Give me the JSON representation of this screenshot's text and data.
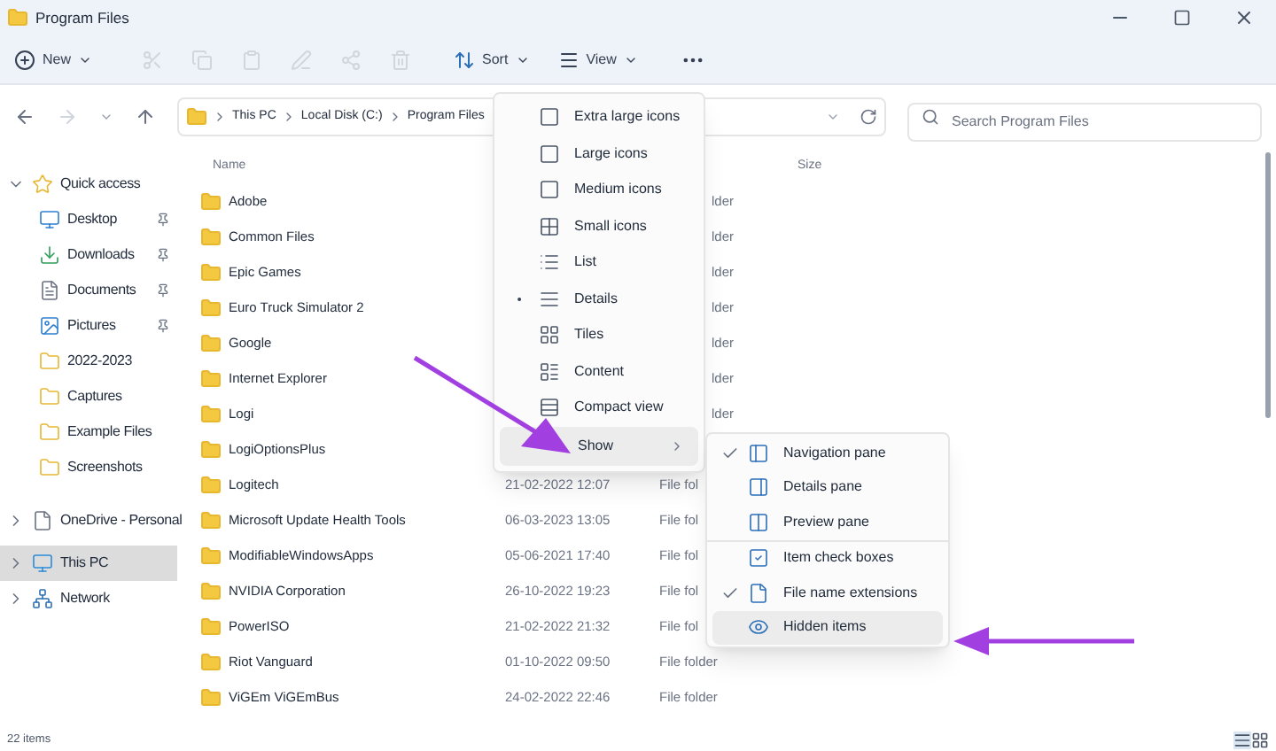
{
  "window": {
    "title": "Program Files"
  },
  "toolbar": {
    "new": "New",
    "sort": "Sort",
    "view": "View"
  },
  "address": {
    "crumbs": [
      "This PC",
      "Local Disk (C:)",
      "Program Files"
    ],
    "search_placeholder": "Search Program Files"
  },
  "sidebar": {
    "items": [
      {
        "label": "Quick access",
        "expanded": true,
        "selected": false,
        "children": [
          {
            "label": "Desktop",
            "pinned": true,
            "selected": false
          },
          {
            "label": "Downloads",
            "pinned": true,
            "selected": false
          },
          {
            "label": "Documents",
            "pinned": true,
            "selected": false
          },
          {
            "label": "Pictures",
            "pinned": true,
            "selected": false
          },
          {
            "label": "2022-2023",
            "pinned": false,
            "selected": false
          },
          {
            "label": "Captures",
            "pinned": false,
            "selected": false
          },
          {
            "label": "Example Files",
            "pinned": false,
            "selected": false
          },
          {
            "label": "Screenshots",
            "pinned": false,
            "selected": false
          }
        ]
      },
      {
        "label": "OneDrive - Personal",
        "expanded": false,
        "selected": false
      },
      {
        "label": "This PC",
        "expanded": false,
        "selected": true
      },
      {
        "label": "Network",
        "expanded": false,
        "selected": false
      }
    ]
  },
  "table": {
    "columns": [
      "Name",
      "Size"
    ],
    "rows": [
      {
        "name": "Adobe",
        "type": "lder"
      },
      {
        "name": "Common Files",
        "type": "lder"
      },
      {
        "name": "Epic Games",
        "type": "lder"
      },
      {
        "name": "Euro Truck Simulator 2",
        "type": "lder"
      },
      {
        "name": "Google",
        "type": "lder"
      },
      {
        "name": "Internet Explorer",
        "type": "lder"
      },
      {
        "name": "Logi",
        "type": "lder"
      },
      {
        "name": "LogiOptionsPlus"
      },
      {
        "name": "Logitech",
        "date": "21-02-2022 12:07",
        "type": "File fol"
      },
      {
        "name": "Microsoft Update Health Tools",
        "date": "06-03-2023 13:05",
        "type": "File fol"
      },
      {
        "name": "ModifiableWindowsApps",
        "date": "05-06-2021 17:40",
        "type": "File fol"
      },
      {
        "name": "NVIDIA Corporation",
        "date": "26-10-2022 19:23",
        "type": "File fol"
      },
      {
        "name": "PowerISO",
        "date": "21-02-2022 21:32",
        "type": "File fol"
      },
      {
        "name": "Riot Vanguard",
        "date": "01-10-2022 09:50",
        "type": "File folder"
      },
      {
        "name": "ViGEm ViGEmBus",
        "date": "24-02-2022 22:46",
        "type": "File folder"
      }
    ]
  },
  "status_bar": {
    "count": "22 items"
  },
  "view_menu": {
    "items": [
      {
        "label": "Extra large icons",
        "selected": false,
        "kind": "option"
      },
      {
        "label": "Large icons",
        "selected": false,
        "kind": "option"
      },
      {
        "label": "Medium icons",
        "selected": false,
        "kind": "option"
      },
      {
        "label": "Small icons",
        "selected": false,
        "kind": "option"
      },
      {
        "label": "List",
        "selected": false,
        "kind": "option"
      },
      {
        "label": "Details",
        "selected": true,
        "kind": "option"
      },
      {
        "label": "Tiles",
        "selected": false,
        "kind": "option"
      },
      {
        "label": "Content",
        "selected": false,
        "kind": "option"
      },
      {
        "label": "Compact view",
        "selected": false,
        "kind": "option"
      },
      {
        "label": "Show",
        "selected": true,
        "kind": "submenu"
      }
    ]
  },
  "show_menu": {
    "items": [
      {
        "label": "Navigation pane",
        "checked": true,
        "selected": false
      },
      {
        "label": "Details pane",
        "checked": false,
        "selected": false
      },
      {
        "label": "Preview pane",
        "checked": false,
        "selected": false
      },
      {
        "label": "Item check boxes",
        "checked": false,
        "selected": false
      },
      {
        "label": "File name extensions",
        "checked": true,
        "selected": false
      },
      {
        "label": "Hidden items",
        "checked": false,
        "selected": true
      }
    ]
  }
}
